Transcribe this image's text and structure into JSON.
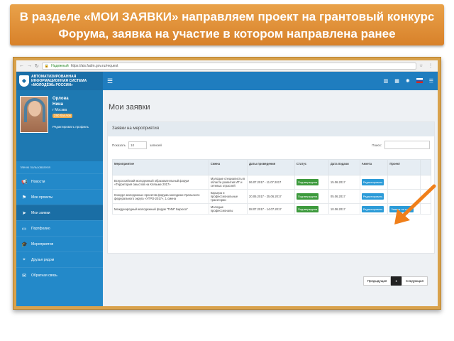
{
  "banner": {
    "line1": "В разделе «МОИ ЗАЯВКИ» направляем проект на грантовый конкурс",
    "line2": "Форума, заявка на участие в котором направлена ранее"
  },
  "browser": {
    "secure_label": "Надежный",
    "url": "https://ais.fadm.gov.ru/request"
  },
  "app": {
    "logo_line1": "АВТОМАТИЗИРОВАННАЯ",
    "logo_line2": "ИНФОРМАЦИОННАЯ СИСТЕМА",
    "logo_line3": "«МОЛОДЁЖЬ РОССИИ»"
  },
  "profile": {
    "surname": "Орлова",
    "name": "Нина",
    "city": "г Москва",
    "points": "250 баллов",
    "edit": "Редактировать профиль"
  },
  "sidebar": {
    "menu_title": "Меню пользователя",
    "items": [
      {
        "label": "Новости",
        "icon": "megaphone-icon"
      },
      {
        "label": "Мои проекты",
        "icon": "flag-icon"
      },
      {
        "label": "Мои заявки",
        "icon": "send-icon"
      },
      {
        "label": "Портфолио",
        "icon": "folder-icon"
      },
      {
        "label": "Мероприятия",
        "icon": "graduation-icon"
      },
      {
        "label": "Друзья рядом",
        "icon": "location-icon"
      },
      {
        "label": "Обратная связь",
        "icon": "mail-icon"
      }
    ]
  },
  "page": {
    "title": "Мои заявки",
    "panel_title": "Заявки на мероприятия",
    "show_label": "Показать",
    "show_value": "10",
    "records_label": "записей",
    "search_label": "Поиск:"
  },
  "table": {
    "headers": [
      "Мероприятие",
      "Смена",
      "Даты проведения",
      "Статус",
      "Дата подачи",
      "Анкета",
      "Проект"
    ],
    "rows": [
      {
        "event": "Всероссийский молодежный образовательный форум «Территория смыслов на Клязьме 2017»",
        "shift": "Молодые специалисты в области развития ИТ и сетевых отраслей",
        "dates": "06.07.2017 - 11.07.2017",
        "status": "Подтверждена",
        "submitted": "15.06.2017",
        "form": "Редактировать",
        "project": ""
      },
      {
        "event": "Конкурс молодежных проектов форума молодежи Уральского федерального округа «УТРО-2017», 1 смена",
        "shift": "Карьера и профессиональные траектории",
        "dates": "20.06.2017 - 25.06.2017",
        "status": "Подтверждена",
        "submitted": "05.06.2017",
        "form": "Редактировать",
        "project": ""
      },
      {
        "event": "Международный молодежный форум \"ТИМ\" Бирюса\"",
        "shift": "Молодые профессионалы",
        "dates": "08.07.2017 - 14.07.2017",
        "status": "Подтверждена",
        "submitted": "10.06.2017",
        "form": "Редактировать",
        "project": "Заявка на грант"
      }
    ]
  },
  "pager": {
    "prev": "Предыдущая",
    "current": "1",
    "next": "Следующая"
  },
  "colors": {
    "banner": "#e0923b",
    "frame": "#d9a24c",
    "topbar": "#1f7dbf",
    "sidebar": "#2389c9",
    "status": "#3d9a3d",
    "button": "#2b9bd8",
    "arrow": "#f07f1a"
  }
}
